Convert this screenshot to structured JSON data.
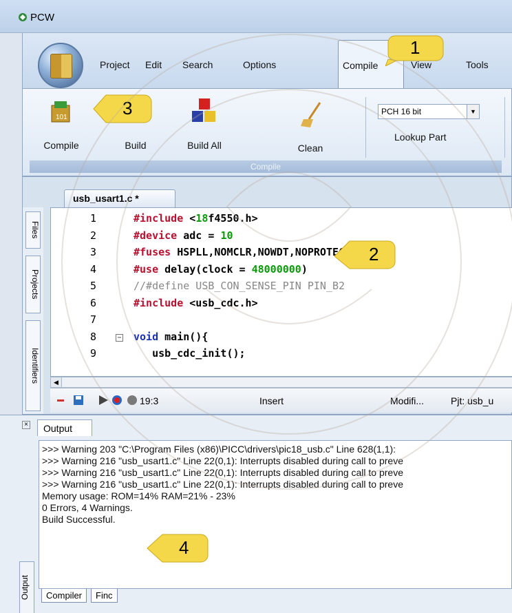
{
  "window": {
    "title": "PCW"
  },
  "ribbon_tabs": [
    "Project",
    "Edit",
    "Search",
    "Options",
    "Compile",
    "View",
    "Tools"
  ],
  "active_tab": "Compile",
  "ribbon": {
    "buttons": [
      {
        "label": "Compile",
        "icon": "compile-icon"
      },
      {
        "label": "Build",
        "icon": "build-icon"
      },
      {
        "label": "Build All",
        "icon": "build-all-icon"
      },
      {
        "label": "Clean",
        "icon": "clean-icon"
      }
    ],
    "group_caption": "Compile",
    "device_select": "PCH 16 bit",
    "lookup_label": "Lookup Part"
  },
  "editor": {
    "tab_label": "usb_usart1.c *",
    "side_tabs": [
      "Files",
      "Projects",
      "Identifiers"
    ],
    "lines": [
      {
        "n": "1",
        "html": "<span class='kw'>#include</span> <span class='plain'>&lt;</span><span class='num'>18</span><span class='plain'>f4550.h&gt;</span>"
      },
      {
        "n": "2",
        "html": "<span class='kw'>#device</span> <span class='plain'>adc = </span><span class='num'>10</span>"
      },
      {
        "n": "3",
        "html": "<span class='kw'>#fuses</span> <span class='plain'>HSPLL,NOMCLR,NOWDT,NOPROTECT,NOLVP</span>"
      },
      {
        "n": "4",
        "html": "<span class='kw'>#use</span> <span class='plain'>delay(clock = </span><span class='num'>48000000</span><span class='plain'>)</span>"
      },
      {
        "n": "5",
        "html": "<span class='cmt'>//#define USB_CON_SENSE_PIN PIN_B2</span>"
      },
      {
        "n": "6",
        "html": "<span class='kw'>#include</span> <span class='plain'>&lt;usb_cdc.h&gt;</span>"
      },
      {
        "n": "7",
        "html": ""
      },
      {
        "n": "8",
        "html": "<span class='kw-blue'>void</span> <span class='plain'>main(){</span>"
      },
      {
        "n": "9",
        "html": "<span class='plain'>   usb_cdc_init();</span>"
      }
    ],
    "status": {
      "position": "19:3",
      "mode": "Insert",
      "modified": "Modifi...",
      "project": "Pjt: usb_u"
    }
  },
  "output": {
    "tab_label": "Output",
    "side_label": "Output",
    "lines": [
      ">>> Warning 203 \"C:\\Program Files (x86)\\PICC\\drivers\\pic18_usb.c\" Line 628(1,1): ",
      ">>> Warning 216 \"usb_usart1.c\" Line 22(0,1): Interrupts disabled during call to preve",
      ">>> Warning 216 \"usb_usart1.c\" Line 22(0,1): Interrupts disabled during call to preve",
      ">>> Warning 216 \"usb_usart1.c\" Line 22(0,1): Interrupts disabled during call to preve",
      "      Memory usage:   ROM=14%      RAM=21% - 23%",
      "      0 Errors,  4 Warnings.",
      "Build Successful."
    ],
    "bottom_tabs": [
      "Compiler",
      "Finc"
    ]
  },
  "callouts": [
    "1",
    "2",
    "3",
    "4"
  ]
}
